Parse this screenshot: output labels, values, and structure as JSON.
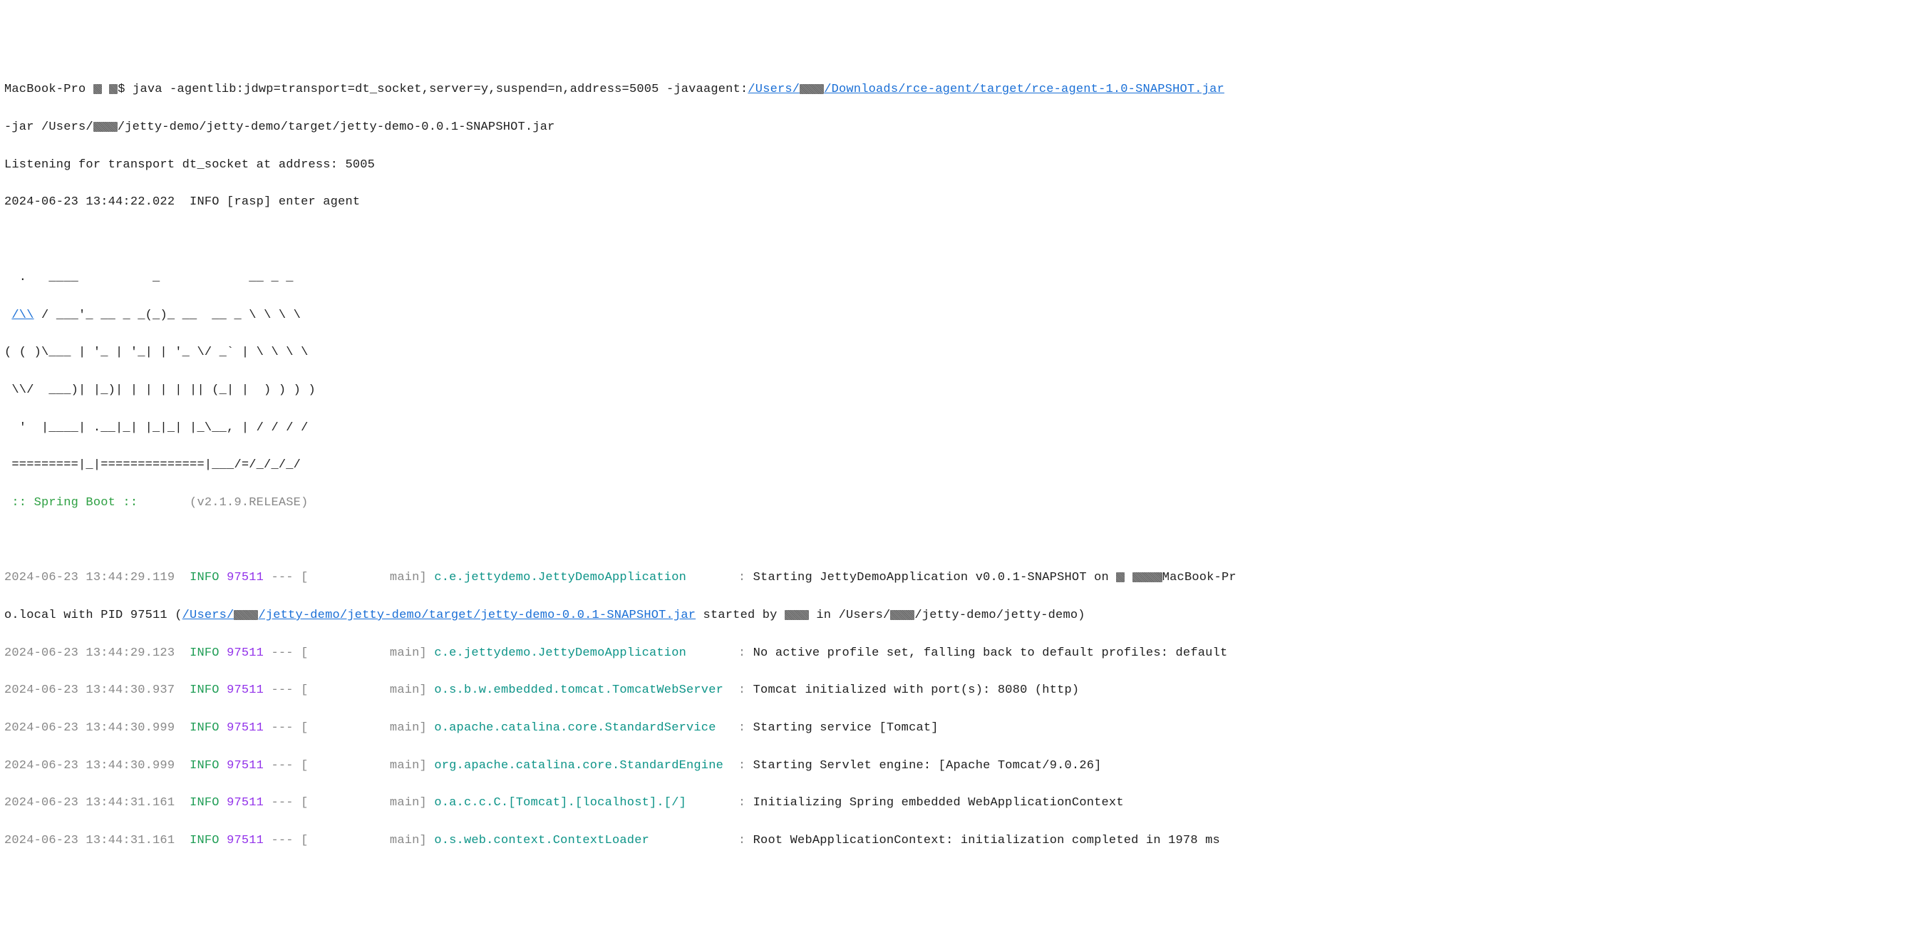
{
  "cmd": {
    "prefix": "MacBook-Pro ",
    "prompt_dollar": "$ ",
    "java_part1": "java -agentlib:jdwp=transport=dt_socket,server=y,suspend=n,address=5005 -javaagent:",
    "agent_path_pre": "/Users/",
    "agent_path_post": "/Downloads/rce-agent/target/rce-agent-1.0-SNAPSHOT.jar",
    "java_line2_pre": "-jar /Users/",
    "java_line2_post": "/jetty-demo/jetty-demo/target/jetty-demo-0.0.1-SNAPSHOT.jar"
  },
  "listening": "Listening for transport dt_socket at address: 5005",
  "enter_agent": {
    "ts": "2024-06-23 13:44:22.022",
    "rest": "  INFO [rasp] enter agent"
  },
  "banner": {
    "l1": "  .   ____          _            __ _ _",
    "l2a": " ",
    "l2b": "/\\\\",
    "l2c": " / ___'_ __ _ _(_)_ __  __ _ \\ \\ \\ \\",
    "l3": "( ( )\\___ | '_ | '_| | '_ \\/ _` | \\ \\ \\ \\",
    "l4": " \\\\/  ___)| |_)| | | | | || (_| |  ) ) ) )",
    "l5": "  '  |____| .__|_| |_|_| |_\\__, | / / / /",
    "l6": " =========|_|==============|___/=/_/_/_/",
    "l7a": " :: Spring Boot ::",
    "l7b": "       (v2.1.9.RELEASE)"
  },
  "logs": [
    {
      "ts": "2024-06-23 13:44:29.119",
      "level": "INFO",
      "pid": "97511",
      "sep": " --- [           main] ",
      "logger": "c.e.jettydemo.JettyDemoApplication      ",
      "sep2": " : ",
      "msg": "Starting JettyDemoApplication v0.0.1-SNAPSHOT on "
    },
    {
      "cont": true,
      "cont_pre": "o.local with PID 97511 (",
      "cont_link_pre": "/Users/",
      "cont_link_post": "/jetty-demo/jetty-demo/target/jetty-demo-0.0.1-SNAPSHOT.jar",
      "cont_mid": " started by ",
      "cont_in": " in /Users/",
      "cont_tail": "/jetty-demo/jetty-demo)"
    },
    {
      "ts": "2024-06-23 13:44:29.123",
      "level": "INFO",
      "pid": "97511",
      "sep": " --- [           main] ",
      "logger": "c.e.jettydemo.JettyDemoApplication      ",
      "sep2": " : ",
      "msg": "No active profile set, falling back to default profiles: default"
    },
    {
      "ts": "2024-06-23 13:44:30.937",
      "level": "INFO",
      "pid": "97511",
      "sep": " --- [           main] ",
      "logger": "o.s.b.w.embedded.tomcat.TomcatWebServer ",
      "sep2": " : ",
      "msg": "Tomcat initialized with port(s): 8080 (http)"
    },
    {
      "ts": "2024-06-23 13:44:30.999",
      "level": "INFO",
      "pid": "97511",
      "sep": " --- [           main] ",
      "logger": "o.apache.catalina.core.StandardService  ",
      "sep2": " : ",
      "msg": "Starting service [Tomcat]"
    },
    {
      "ts": "2024-06-23 13:44:30.999",
      "level": "INFO",
      "pid": "97511",
      "sep": " --- [           main] ",
      "logger": "org.apache.catalina.core.StandardEngine ",
      "sep2": " : ",
      "msg": "Starting Servlet engine: [Apache Tomcat/9.0.26]"
    },
    {
      "ts": "2024-06-23 13:44:31.161",
      "level": "INFO",
      "pid": "97511",
      "sep": " --- [           main] ",
      "logger": "o.a.c.c.C.[Tomcat].[localhost].[/]      ",
      "sep2": " : ",
      "msg": "Initializing Spring embedded WebApplicationContext"
    },
    {
      "ts": "2024-06-23 13:44:31.161",
      "level": "INFO",
      "pid": "97511",
      "sep": " --- [           main] ",
      "logger": "o.s.web.context.ContextLoader           ",
      "sep2": " : ",
      "msg": "Root WebApplicationContext: initialization completed in 1978 ms"
    }
  ],
  "macbook_tail": "MacBook-Pr"
}
